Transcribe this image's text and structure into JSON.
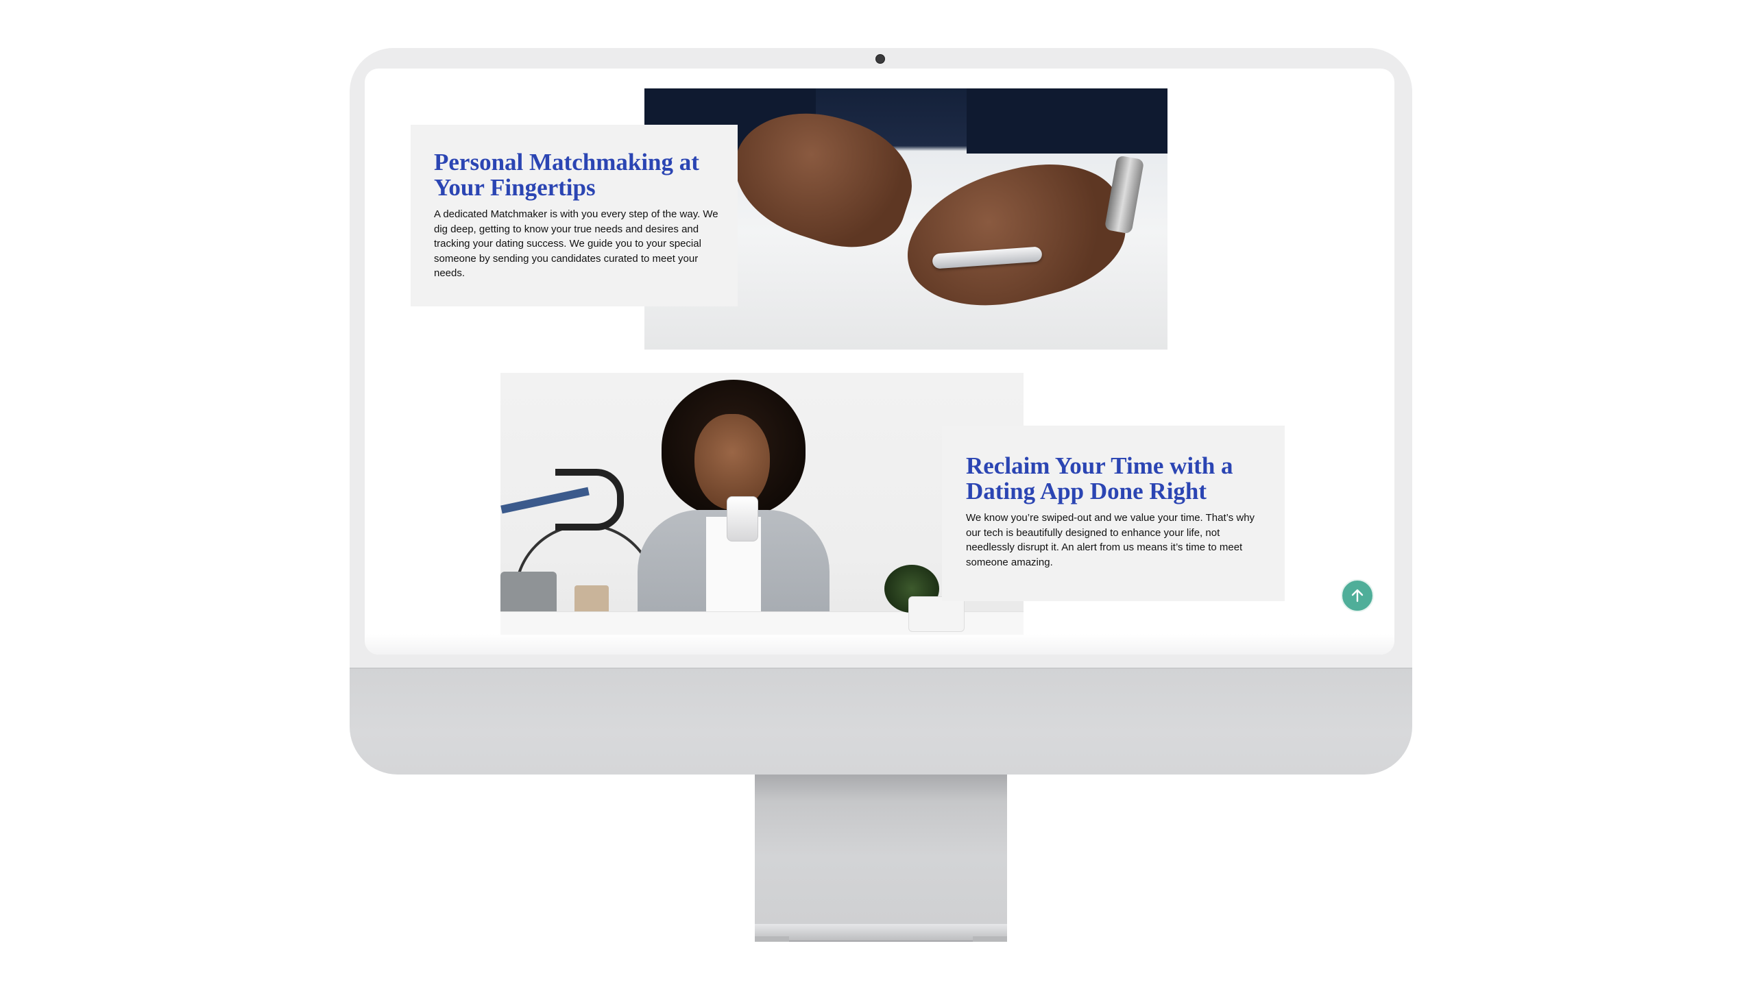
{
  "colors": {
    "heading": "#2b45b3",
    "card_bg": "#f2f2f2",
    "accent_button": "#4fae99",
    "device_frame": "#ececed",
    "device_chin": "#d3d4d6"
  },
  "sections": [
    {
      "title": "Personal Matchmaking at Your Fingertips",
      "body": "A dedicated Matchmaker is with you every step of the way. We dig deep, getting to know your true needs and desires and tracking your dating success. We guide you to your special someone by sending you candidates curated to meet your needs.",
      "image": "hands-holding-smartphone-photo"
    },
    {
      "title": "Reclaim Your Time with a Dating App Done Right",
      "body": "We know you’re swiped-out and we value your time. That’s why our tech is beautifully designed to enhance your life, not needlessly disrupt it. An alert from us means it’s time to meet someone amazing.",
      "image": "woman-smiling-at-phone-photo"
    }
  ],
  "scroll_top": {
    "icon": "arrow-up-icon"
  }
}
